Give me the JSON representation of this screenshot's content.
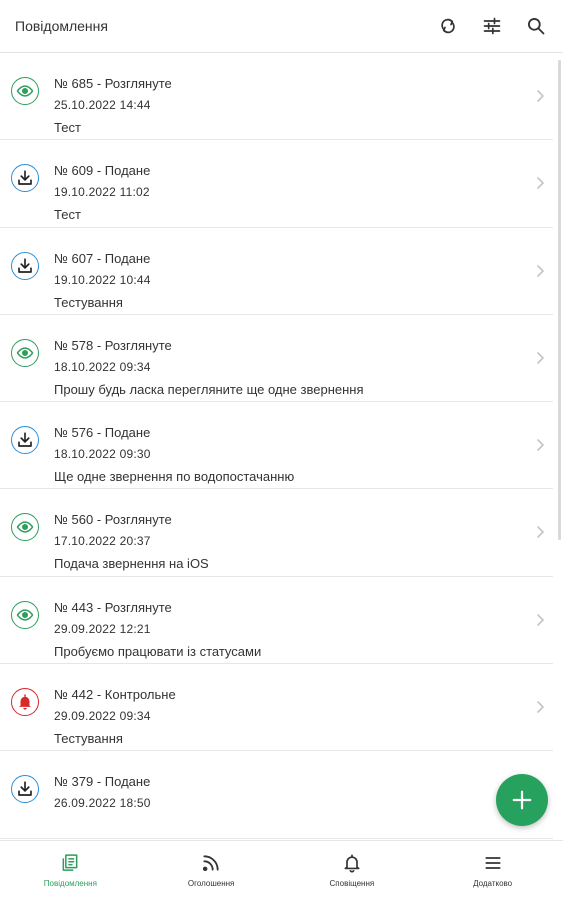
{
  "header": {
    "title": "Повідомлення",
    "actions": [
      {
        "icon": "refresh-icon"
      },
      {
        "icon": "filter-icon"
      },
      {
        "icon": "search-icon"
      }
    ]
  },
  "items": [
    {
      "status": "reviewed",
      "icon": "eye-icon",
      "title": "№ 685 - Розглянуте",
      "date": "25.10.2022 14:44",
      "description": "Тест"
    },
    {
      "status": "submitted",
      "icon": "download-icon",
      "title": "№ 609 - Подане",
      "date": "19.10.2022 11:02",
      "description": "Тест"
    },
    {
      "status": "submitted",
      "icon": "download-icon",
      "title": "№ 607 - Подане",
      "date": "19.10.2022 10:44",
      "description": "Тестування"
    },
    {
      "status": "reviewed",
      "icon": "eye-icon",
      "title": "№ 578 - Розглянуте",
      "date": "18.10.2022 09:34",
      "description": "Прошу будь ласка перегляните ще одне звернення"
    },
    {
      "status": "submitted",
      "icon": "download-icon",
      "title": "№ 576 - Подане",
      "date": "18.10.2022 09:30",
      "description": "Ще одне звернення по водопостачанню"
    },
    {
      "status": "reviewed",
      "icon": "eye-icon",
      "title": "№ 560 - Розглянуте",
      "date": "17.10.2022 20:37",
      "description": "Подача звернення на iOS"
    },
    {
      "status": "reviewed",
      "icon": "eye-icon",
      "title": "№ 443 - Розглянуте",
      "date": "29.09.2022 12:21",
      "description": "Пробуємо працювати із статусами"
    },
    {
      "status": "control",
      "icon": "bell-icon",
      "title": "№ 442 - Контрольне",
      "date": "29.09.2022 09:34",
      "description": "Тестування"
    },
    {
      "status": "submitted",
      "icon": "download-icon",
      "title": "№ 379 - Подане",
      "date": "26.09.2022 18:50",
      "description": ""
    }
  ],
  "fab": {
    "icon": "plus-icon"
  },
  "bottom_nav": [
    {
      "label": "Повідомлення",
      "icon": "messages-icon",
      "active": true
    },
    {
      "label": "Оголошення",
      "icon": "rss-icon",
      "active": false
    },
    {
      "label": "Сповіщення",
      "icon": "bell-icon",
      "active": false
    },
    {
      "label": "Додатково",
      "icon": "menu-icon",
      "active": false
    }
  ],
  "colors": {
    "accent": "#27a25e",
    "reviewed": "#2e9e5b",
    "submitted": "#2b8fd6",
    "control": "#d42a2a"
  }
}
